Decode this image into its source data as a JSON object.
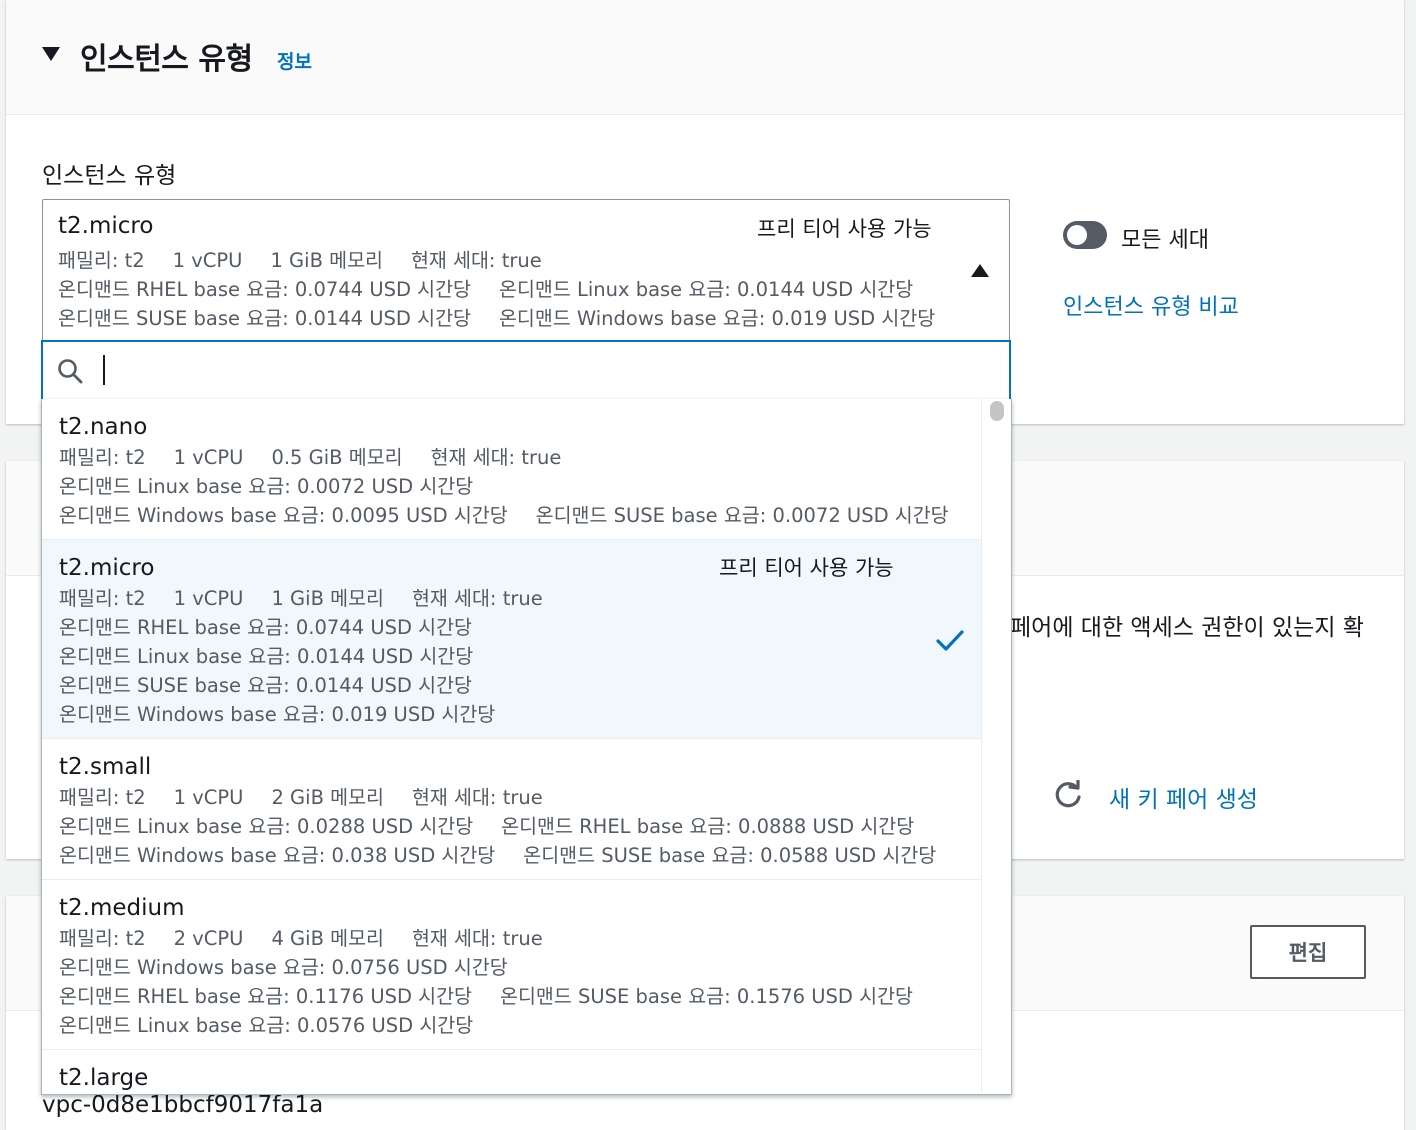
{
  "section": {
    "title": "인스턴스 유형",
    "info_link": "정보"
  },
  "field_label": "인스턴스 유형",
  "selected": {
    "name": "t2.micro",
    "free_tier": "프리 티어 사용 가능",
    "row1": [
      "패밀리: t2",
      "1 vCPU",
      "1 GiB 메모리",
      "현재 세대: true"
    ],
    "row2": [
      "온디맨드 RHEL base 요금: 0.0744 USD 시간당",
      "온디맨드 Linux base 요금: 0.0144 USD 시간당"
    ],
    "row3": [
      "온디맨드 SUSE base 요금: 0.0144 USD 시간당",
      "온디맨드 Windows base 요금: 0.019 USD 시간당"
    ]
  },
  "toggle": {
    "label": "모든 세대",
    "on": false
  },
  "compare_link": "인스턴스 유형 비교",
  "search": {
    "value": ""
  },
  "options": [
    {
      "name": "t2.nano",
      "free_tier": "",
      "selected": false,
      "lines": [
        [
          "패밀리: t2",
          "1 vCPU",
          "0.5 GiB 메모리",
          "현재 세대: true"
        ],
        [
          "온디맨드 Linux base 요금: 0.0072 USD 시간당"
        ],
        [
          "온디맨드 Windows base 요금: 0.0095 USD 시간당",
          "온디맨드 SUSE base 요금: 0.0072 USD 시간당"
        ]
      ]
    },
    {
      "name": "t2.micro",
      "free_tier": "프리 티어 사용 가능",
      "selected": true,
      "lines": [
        [
          "패밀리: t2",
          "1 vCPU",
          "1 GiB 메모리",
          "현재 세대: true"
        ],
        [
          "온디맨드 RHEL base 요금: 0.0744 USD 시간당"
        ],
        [
          "온디맨드 Linux base 요금: 0.0144 USD 시간당"
        ],
        [
          "온디맨드 SUSE base 요금: 0.0144 USD 시간당"
        ],
        [
          "온디맨드 Windows base 요금: 0.019 USD 시간당"
        ]
      ]
    },
    {
      "name": "t2.small",
      "free_tier": "",
      "selected": false,
      "lines": [
        [
          "패밀리: t2",
          "1 vCPU",
          "2 GiB 메모리",
          "현재 세대: true"
        ],
        [
          "온디맨드 Linux base 요금: 0.0288 USD 시간당",
          "온디맨드 RHEL base 요금: 0.0888 USD 시간당"
        ],
        [
          "온디맨드 Windows base 요금: 0.038 USD 시간당",
          "온디맨드 SUSE base 요금: 0.0588 USD 시간당"
        ]
      ]
    },
    {
      "name": "t2.medium",
      "free_tier": "",
      "selected": false,
      "lines": [
        [
          "패밀리: t2",
          "2 vCPU",
          "4 GiB 메모리",
          "현재 세대: true"
        ],
        [
          "온디맨드 Windows base 요금: 0.0756 USD 시간당"
        ],
        [
          "온디맨드 RHEL base 요금: 0.1176 USD 시간당",
          "온디맨드 SUSE base 요금: 0.1576 USD 시간당"
        ],
        [
          "온디맨드 Linux base 요금: 0.0576 USD 시간당"
        ]
      ]
    },
    {
      "name": "t2.large",
      "free_tier": "",
      "selected": false,
      "lines": []
    }
  ],
  "key_pair": {
    "partial_text": "페어에 대한 액세스 권한이 있는지 확",
    "new_link": "새 키 페어 생성"
  },
  "edit_button": "편집",
  "vpc_id": "vpc-0d8e1bbcf9017fa1a",
  "colors": {
    "link": "#0073bb",
    "selected_bg": "#f1f8fb",
    "text": "#16191f",
    "secondary": "#545b64"
  }
}
